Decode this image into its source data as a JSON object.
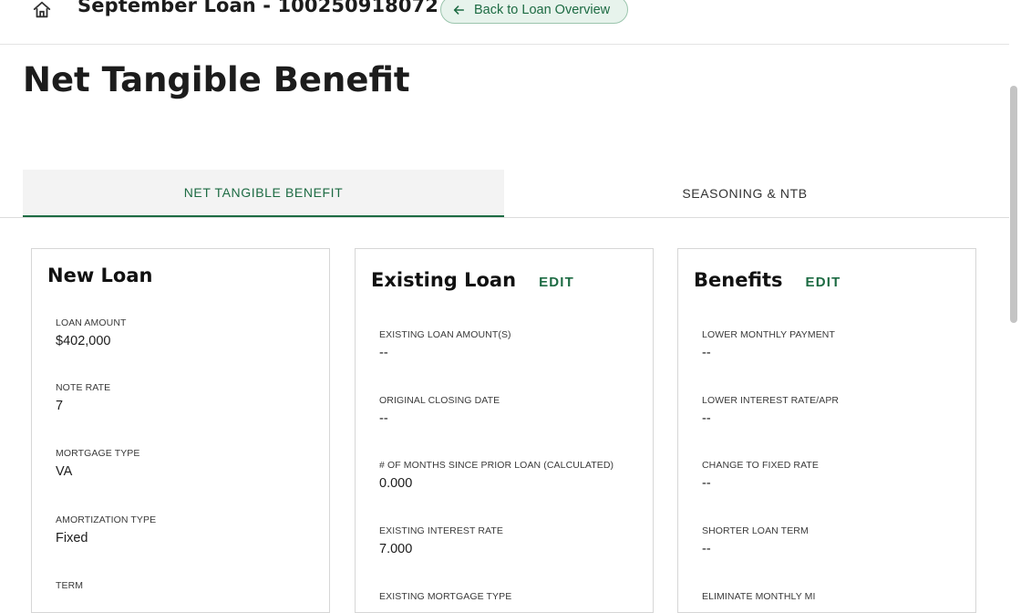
{
  "header": {
    "loan_title": "September Loan - 100250918072",
    "back_label": "Back to Loan Overview"
  },
  "page": {
    "title": "Net Tangible Benefit"
  },
  "tabs": [
    {
      "label": "NET TANGIBLE BENEFIT",
      "active": true
    },
    {
      "label": "SEASONING & NTB",
      "active": false
    }
  ],
  "new_loan": {
    "title": "New Loan",
    "fields": [
      {
        "label": "LOAN AMOUNT",
        "value": "$402,000"
      },
      {
        "label": "NOTE RATE",
        "value": "7"
      },
      {
        "label": "MORTGAGE TYPE",
        "value": "VA"
      },
      {
        "label": "AMORTIZATION TYPE",
        "value": "Fixed"
      },
      {
        "label": "TERM",
        "value": ""
      }
    ]
  },
  "existing_loan": {
    "title": "Existing Loan",
    "edit_label": "EDIT",
    "fields": [
      {
        "label": "EXISTING LOAN AMOUNT(S)",
        "value": "--"
      },
      {
        "label": "ORIGINAL CLOSING DATE",
        "value": "--"
      },
      {
        "label": "# OF MONTHS SINCE PRIOR LOAN (CALCULATED)",
        "value": "0.000"
      },
      {
        "label": "EXISTING INTEREST RATE",
        "value": "7.000"
      },
      {
        "label": "EXISTING MORTGAGE TYPE",
        "value": ""
      }
    ]
  },
  "benefits": {
    "title": "Benefits",
    "edit_label": "EDIT",
    "fields": [
      {
        "label": "LOWER MONTHLY PAYMENT",
        "value": "--"
      },
      {
        "label": "LOWER INTEREST RATE/APR",
        "value": "--"
      },
      {
        "label": "CHANGE TO FIXED RATE",
        "value": "--"
      },
      {
        "label": "SHORTER LOAN TERM",
        "value": "--"
      },
      {
        "label": "ELIMINATE MONTHLY MI",
        "value": ""
      }
    ]
  },
  "colors": {
    "accent": "#1d6b43",
    "back_button_bg": "#e7f3ec",
    "tab_active_bg": "#f3f3f3"
  },
  "icons": {
    "home": "home-icon",
    "back": "arrow-left-icon"
  }
}
